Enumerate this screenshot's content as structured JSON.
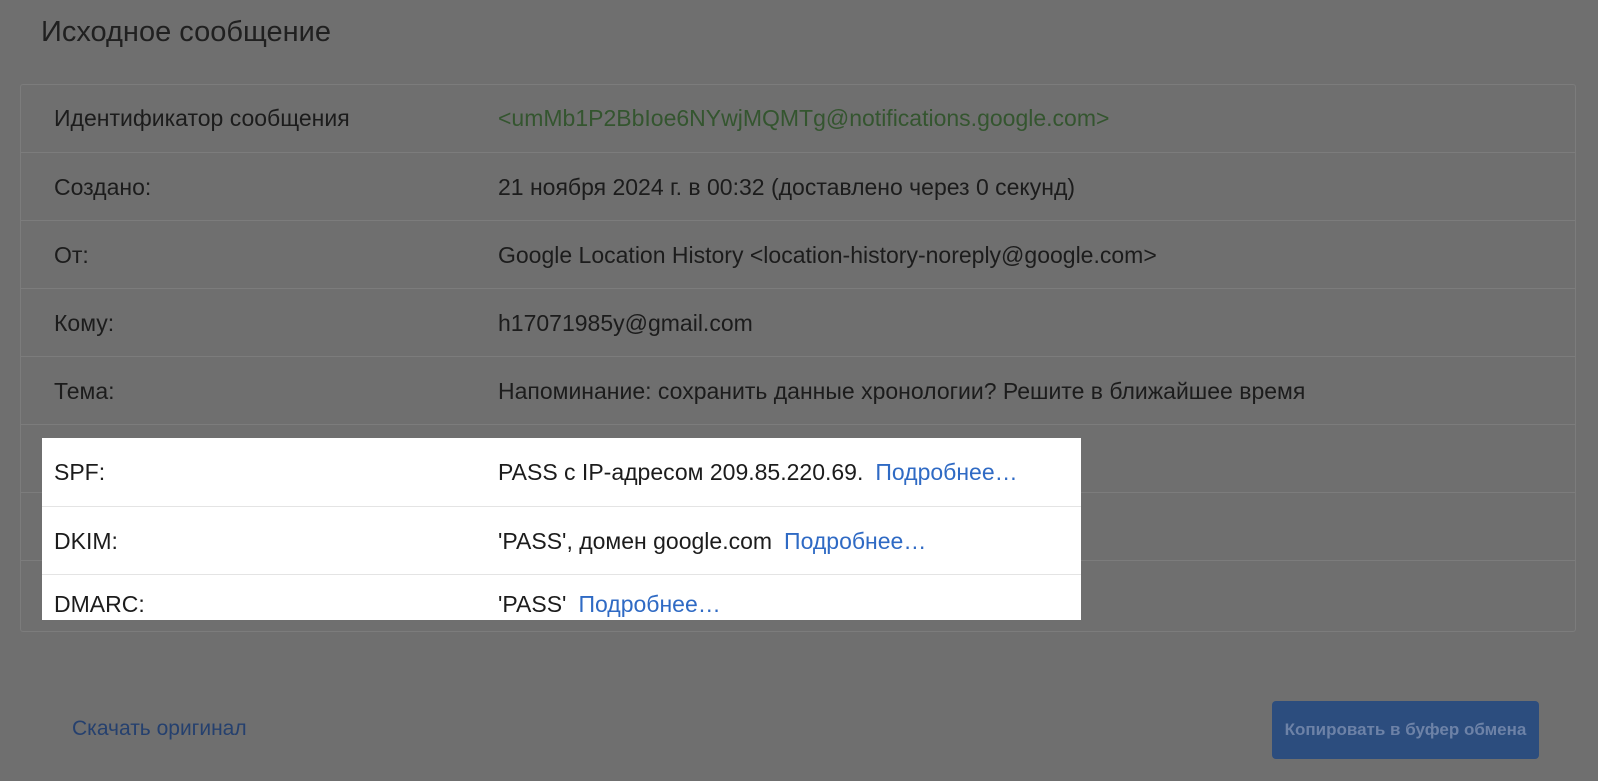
{
  "page_title": "Исходное сообщение",
  "rows": [
    {
      "label": "Идентификатор сообщения",
      "value": "<umMb1P2BbIoe6NYwjMQMTg@notifications.google.com>"
    },
    {
      "label": "Создано:",
      "value": "21 ноября 2024 г. в 00:32 (доставлено через 0 секунд)"
    },
    {
      "label": "От:",
      "value": "Google Location History <location-history-noreply@google.com>"
    },
    {
      "label": "Кому:",
      "value": "h17071985y@gmail.com"
    },
    {
      "label": "Тема:",
      "value": "Напоминание: сохранить данные хронологии? Решите в ближайшее время"
    },
    {
      "label": "SPF:",
      "value": "PASS с IP-адресом 209.85.220.69.",
      "link": "Подробнее…"
    },
    {
      "label": "DKIM:",
      "value": "'PASS', домен google.com",
      "link": "Подробнее…"
    },
    {
      "label": "DMARC:",
      "value": "'PASS'",
      "link": "Подробнее…"
    }
  ],
  "footer": {
    "download_label": "Скачать оригинал",
    "copy_label": "Копировать в буфер обмена"
  },
  "colors": {
    "overlay_background": "#6f6f6f",
    "message_id_text": "#34552f",
    "link": "#2f6ac4",
    "copy_button": "#2c4d7e",
    "highlight_background": "#ffffff"
  }
}
